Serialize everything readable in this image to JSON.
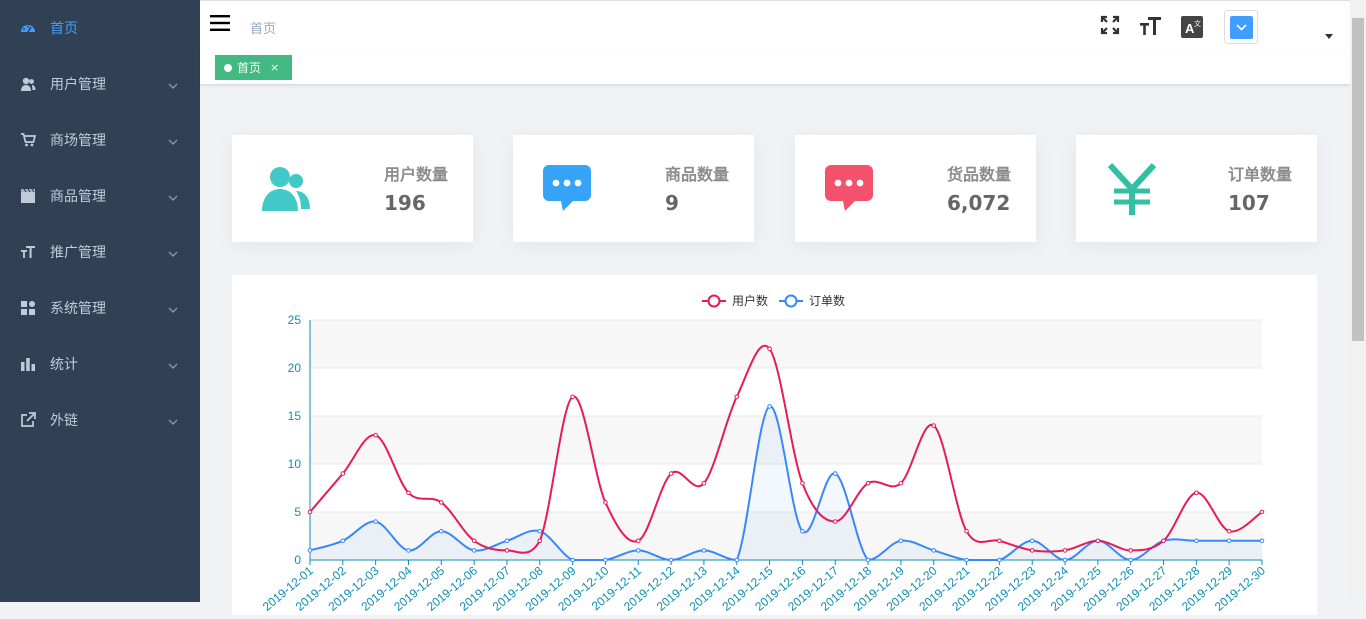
{
  "sidebar": {
    "items": [
      {
        "label": "首页",
        "icon": "dashboard-icon",
        "active": true,
        "has_arrow": false
      },
      {
        "label": "用户管理",
        "icon": "users-icon",
        "active": false,
        "has_arrow": true
      },
      {
        "label": "商场管理",
        "icon": "cart-icon",
        "active": false,
        "has_arrow": true
      },
      {
        "label": "商品管理",
        "icon": "clapperboard-icon",
        "active": false,
        "has_arrow": true
      },
      {
        "label": "推广管理",
        "icon": "font-size-icon",
        "active": false,
        "has_arrow": true
      },
      {
        "label": "系统管理",
        "icon": "grid-icon",
        "active": false,
        "has_arrow": true
      },
      {
        "label": "统计",
        "icon": "bar-chart-icon",
        "active": false,
        "has_arrow": true
      },
      {
        "label": "外链",
        "icon": "external-link-icon",
        "active": false,
        "has_arrow": true
      }
    ]
  },
  "header": {
    "breadcrumb": "首页",
    "tools": [
      "fullscreen-icon",
      "font-size-icon",
      "translate-icon"
    ]
  },
  "tags": [
    {
      "label": "首页",
      "close": "×"
    }
  ],
  "cards": [
    {
      "label": "用户数量",
      "value": "196",
      "icon": "users-icon",
      "color": "#40c9c6"
    },
    {
      "label": "商品数量",
      "value": "9",
      "icon": "message-icon",
      "color": "#36a3f7"
    },
    {
      "label": "货品数量",
      "value": "6,072",
      "icon": "message-icon",
      "color": "#f4516c"
    },
    {
      "label": "订单数量",
      "value": "107",
      "icon": "yen-icon",
      "color": "#34bfa3"
    }
  ],
  "colors": {
    "sidebar_bg": "#304156",
    "active": "#409eff",
    "tag": "#42b983",
    "user_line": "#e61b5a",
    "order_line": "#3888fa"
  },
  "chart_data": {
    "type": "line",
    "x": [
      "2019-12-01",
      "2019-12-02",
      "2019-12-03",
      "2019-12-04",
      "2019-12-05",
      "2019-12-06",
      "2019-12-07",
      "2019-12-08",
      "2019-12-09",
      "2019-12-10",
      "2019-12-11",
      "2019-12-12",
      "2019-12-13",
      "2019-12-14",
      "2019-12-15",
      "2019-12-16",
      "2019-12-17",
      "2019-12-18",
      "2019-12-19",
      "2019-12-20",
      "2019-12-21",
      "2019-12-22",
      "2019-12-23",
      "2019-12-24",
      "2019-12-25",
      "2019-12-26",
      "2019-12-27",
      "2019-12-28",
      "2019-12-29",
      "2019-12-30"
    ],
    "series": [
      {
        "name": "用户数",
        "color": "#e61b5a",
        "values": [
          5,
          9,
          13,
          7,
          6,
          2,
          1,
          2,
          17,
          6,
          2,
          9,
          8,
          17,
          22,
          8,
          4,
          8,
          8,
          14,
          3,
          2,
          1,
          1,
          2,
          1,
          2,
          7,
          3,
          5
        ],
        "area": false
      },
      {
        "name": "订单数",
        "color": "#3888fa",
        "values": [
          1,
          2,
          4,
          1,
          3,
          1,
          2,
          3,
          0,
          0,
          1,
          0,
          1,
          0,
          16,
          3,
          9,
          0,
          2,
          1,
          0,
          0,
          2,
          0,
          2,
          0,
          2,
          2,
          2,
          2
        ],
        "area": true
      }
    ],
    "ylim": [
      0,
      25
    ],
    "yticks": [
      0,
      5,
      10,
      15,
      20,
      25
    ],
    "legend": "top-center",
    "grid": true,
    "smooth": true
  }
}
